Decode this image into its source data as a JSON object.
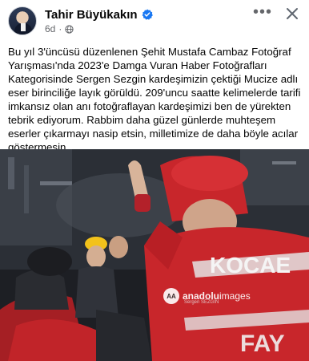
{
  "post": {
    "author": "Tahir Büyükakın",
    "timestamp": "6d",
    "audience_icon": "globe-icon",
    "verified_icon": "verified-badge-icon",
    "text": "Bu yıl 3'üncüsü düzenlenen Şehit Mustafa Cambaz Fotoğraf Yarışması'nda 2023'e Damga Vuran Haber Fotoğrafları Kategorisinde Sergen Sezgin kardeşimizin çektiği Mucize adlı eser birinciliğe layık görüldü. 209'uncu saatte kelimelerde tarifi imkansız olan anı fotoğraflayan kardeşimizi ben de yürekten tebrik ediyorum. Rabbim daha güzel günlerde muhteşem eserler çıkarmayı nasip etsin, milletimize de daha böyle acılar göstermesin."
  },
  "actions": {
    "more_label": "•••",
    "close_icon": "close-icon"
  },
  "photo": {
    "jacket_text_1": "KOCAE",
    "jacket_text_2": "FAY",
    "watermark_brand_bold": "anadolu",
    "watermark_brand_light": "images",
    "watermark_logo": "AA",
    "watermark_credit": "Sergen SEZGİN"
  },
  "colors": {
    "verified": "#1877f2",
    "rescue_red": "#c8262b",
    "helmet_yellow": "#f2c21b"
  }
}
